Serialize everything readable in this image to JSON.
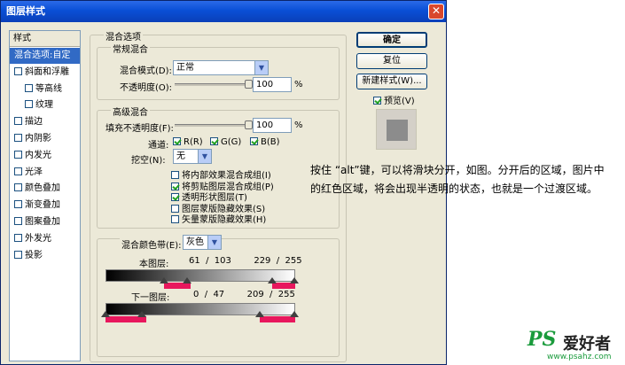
{
  "dialog": {
    "title": "图层样式",
    "close_glyph": "✕"
  },
  "style_list": {
    "header": "样式",
    "items": [
      {
        "label": "混合选项:自定",
        "checkbox": false,
        "selected": true
      },
      {
        "label": "斜面和浮雕",
        "checkbox": true,
        "checked": false
      },
      {
        "label": "等高线",
        "checkbox": true,
        "checked": false,
        "indent": true
      },
      {
        "label": "纹理",
        "checkbox": true,
        "checked": false,
        "indent": true
      },
      {
        "label": "描边",
        "checkbox": true,
        "checked": false
      },
      {
        "label": "内阴影",
        "checkbox": true,
        "checked": false
      },
      {
        "label": "内发光",
        "checkbox": true,
        "checked": false
      },
      {
        "label": "光泽",
        "checkbox": true,
        "checked": false
      },
      {
        "label": "颜色叠加",
        "checkbox": true,
        "checked": false
      },
      {
        "label": "渐变叠加",
        "checkbox": true,
        "checked": false
      },
      {
        "label": "图案叠加",
        "checkbox": true,
        "checked": false
      },
      {
        "label": "外发光",
        "checkbox": true,
        "checked": false
      },
      {
        "label": "投影",
        "checkbox": true,
        "checked": false
      }
    ]
  },
  "blend_options": {
    "group_title": "混合选项",
    "general": {
      "title": "常规混合",
      "mode_label": "混合模式(D):",
      "mode_value": "正常",
      "opacity_label": "不透明度(O):",
      "opacity_value": "100",
      "opacity_unit": "%",
      "opacity_level": 1.0
    },
    "advanced": {
      "title": "高级混合",
      "fill_label": "填充不透明度(F):",
      "fill_value": "100",
      "fill_unit": "%",
      "fill_level": 1.0,
      "channels_label": "通道:",
      "channels": [
        {
          "label": "R(R)",
          "checked": true
        },
        {
          "label": "G(G)",
          "checked": true
        },
        {
          "label": "B(B)",
          "checked": true
        }
      ],
      "knockout_label": "挖空(N):",
      "knockout_value": "无",
      "options": [
        {
          "label": "将内部效果混合成组(I)",
          "checked": false
        },
        {
          "label": "将剪贴图层混合成组(P)",
          "checked": true
        },
        {
          "label": "透明形状图层(T)",
          "checked": true
        },
        {
          "label": "图层蒙版隐藏效果(S)",
          "checked": false
        },
        {
          "label": "矢量蒙版隐藏效果(H)",
          "checked": false
        }
      ]
    },
    "blend_if": {
      "label": "混合颜色带(E):",
      "value": "灰色",
      "this_layer_label": "本图层:",
      "this_layer_values": "61  /  103        229  /  255",
      "under_layer_label": "下一图层:",
      "under_layer_values": "0  /  47        209  /  255"
    }
  },
  "buttons": {
    "ok": "确定",
    "reset": "复位",
    "new_style": "新建样式(W)...",
    "preview_label": "预览(V)",
    "preview_checked": true
  },
  "annotation": {
    "text": "按住 “alt”键，可以将滑块分开，如图。分开后的区域，图片中的红色区域，将会出现半透明的状态，也就是一个过渡区域。"
  },
  "watermark": {
    "ps_logo": "PS",
    "site_name": "爱好者",
    "url": "www.psahz.com"
  },
  "colors": {
    "accent": "#316ac5",
    "title_bar": "#0a4fd6",
    "red_marker": "#e8175d",
    "logo_green": "#1a9b3c"
  }
}
